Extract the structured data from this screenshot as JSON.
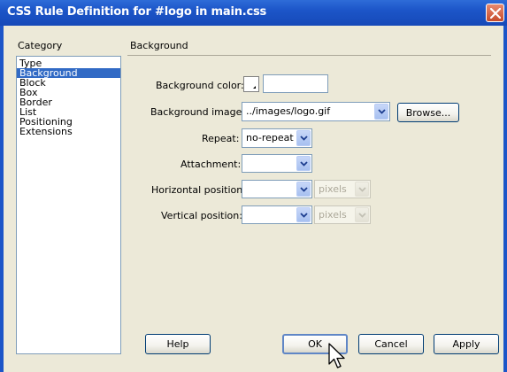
{
  "window": {
    "title": "CSS Rule Definition for #logo in main.css"
  },
  "category": {
    "heading": "Category",
    "items": [
      {
        "label": "Type",
        "selected": false
      },
      {
        "label": "Background",
        "selected": true
      },
      {
        "label": "Block",
        "selected": false
      },
      {
        "label": "Box",
        "selected": false
      },
      {
        "label": "Border",
        "selected": false
      },
      {
        "label": "List",
        "selected": false
      },
      {
        "label": "Positioning",
        "selected": false
      },
      {
        "label": "Extensions",
        "selected": false
      }
    ]
  },
  "section": {
    "title": "Background"
  },
  "fields": {
    "bg_color": {
      "label": "Background color:",
      "value": ""
    },
    "bg_image": {
      "label": "Background image:",
      "value": "../images/logo.gif"
    },
    "repeat": {
      "label": "Repeat:",
      "value": "no-repeat"
    },
    "attachment": {
      "label": "Attachment:",
      "value": ""
    },
    "h_position": {
      "label": "Horizontal position:",
      "value": "",
      "unit": "pixels"
    },
    "v_position": {
      "label": "Vertical position:",
      "value": "",
      "unit": "pixels"
    }
  },
  "buttons": {
    "browse": "Browse...",
    "help": "Help",
    "ok": "OK",
    "cancel": "Cancel",
    "apply": "Apply"
  },
  "icons": {
    "close": "close-icon",
    "dropdown": "chevron-down-icon",
    "swatch": "color-picker-icon",
    "cursor": "mouse-pointer-icon"
  }
}
